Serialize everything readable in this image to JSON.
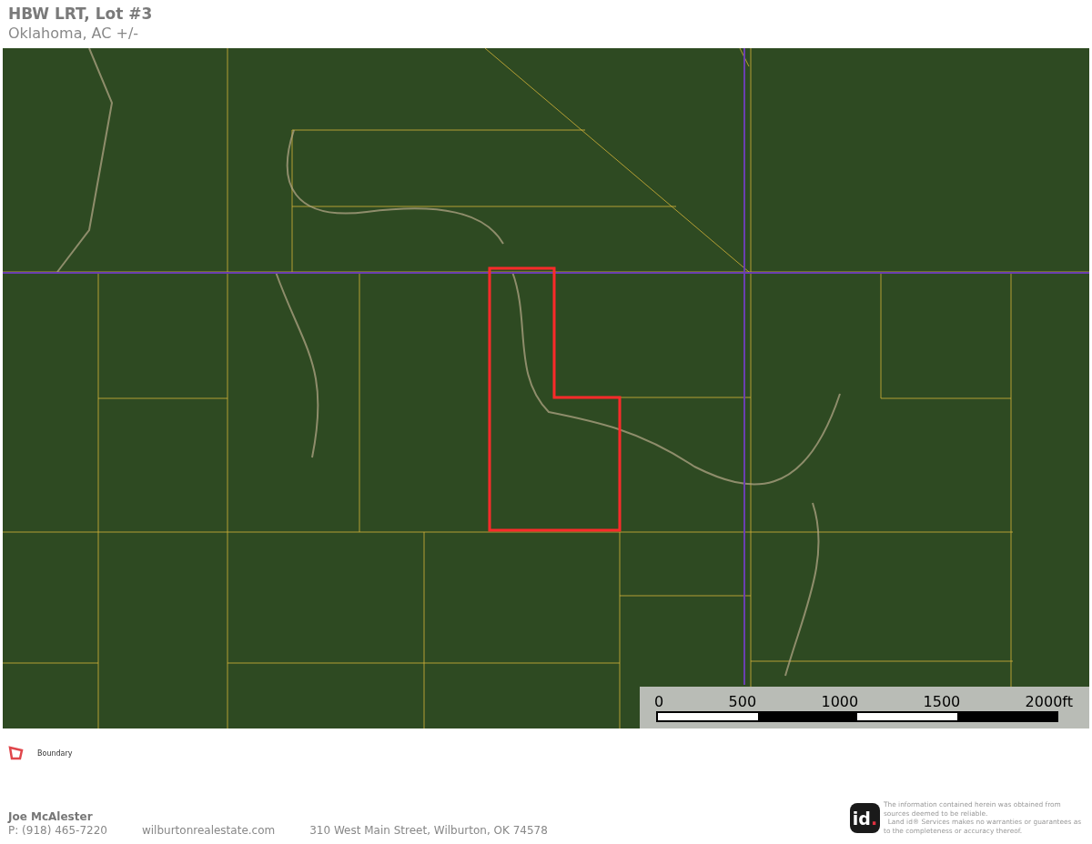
{
  "header": {
    "title": "HBW LRT, Lot #3",
    "subtitle": "Oklahoma,  AC +/-"
  },
  "scale_bar": {
    "ticks": [
      "0",
      "500",
      "1000",
      "1500",
      "2000ft"
    ]
  },
  "legend": [
    {
      "label": "Boundary",
      "color": "#e0474c"
    }
  ],
  "footer": {
    "name": "Joe McAlester",
    "phone": "P: (918) 465-7220",
    "website": "wilburtonrealestate.com",
    "address": "310 West Main Street, Wilburton, OK 74578"
  },
  "logo": {
    "text": "id",
    "mark": "."
  },
  "disclaimer": "The information contained herein was obtained from sources deemed to be reliable.\n  Land id® Services makes no warranties or guarantees as to the completeness or accuracy thereof."
}
